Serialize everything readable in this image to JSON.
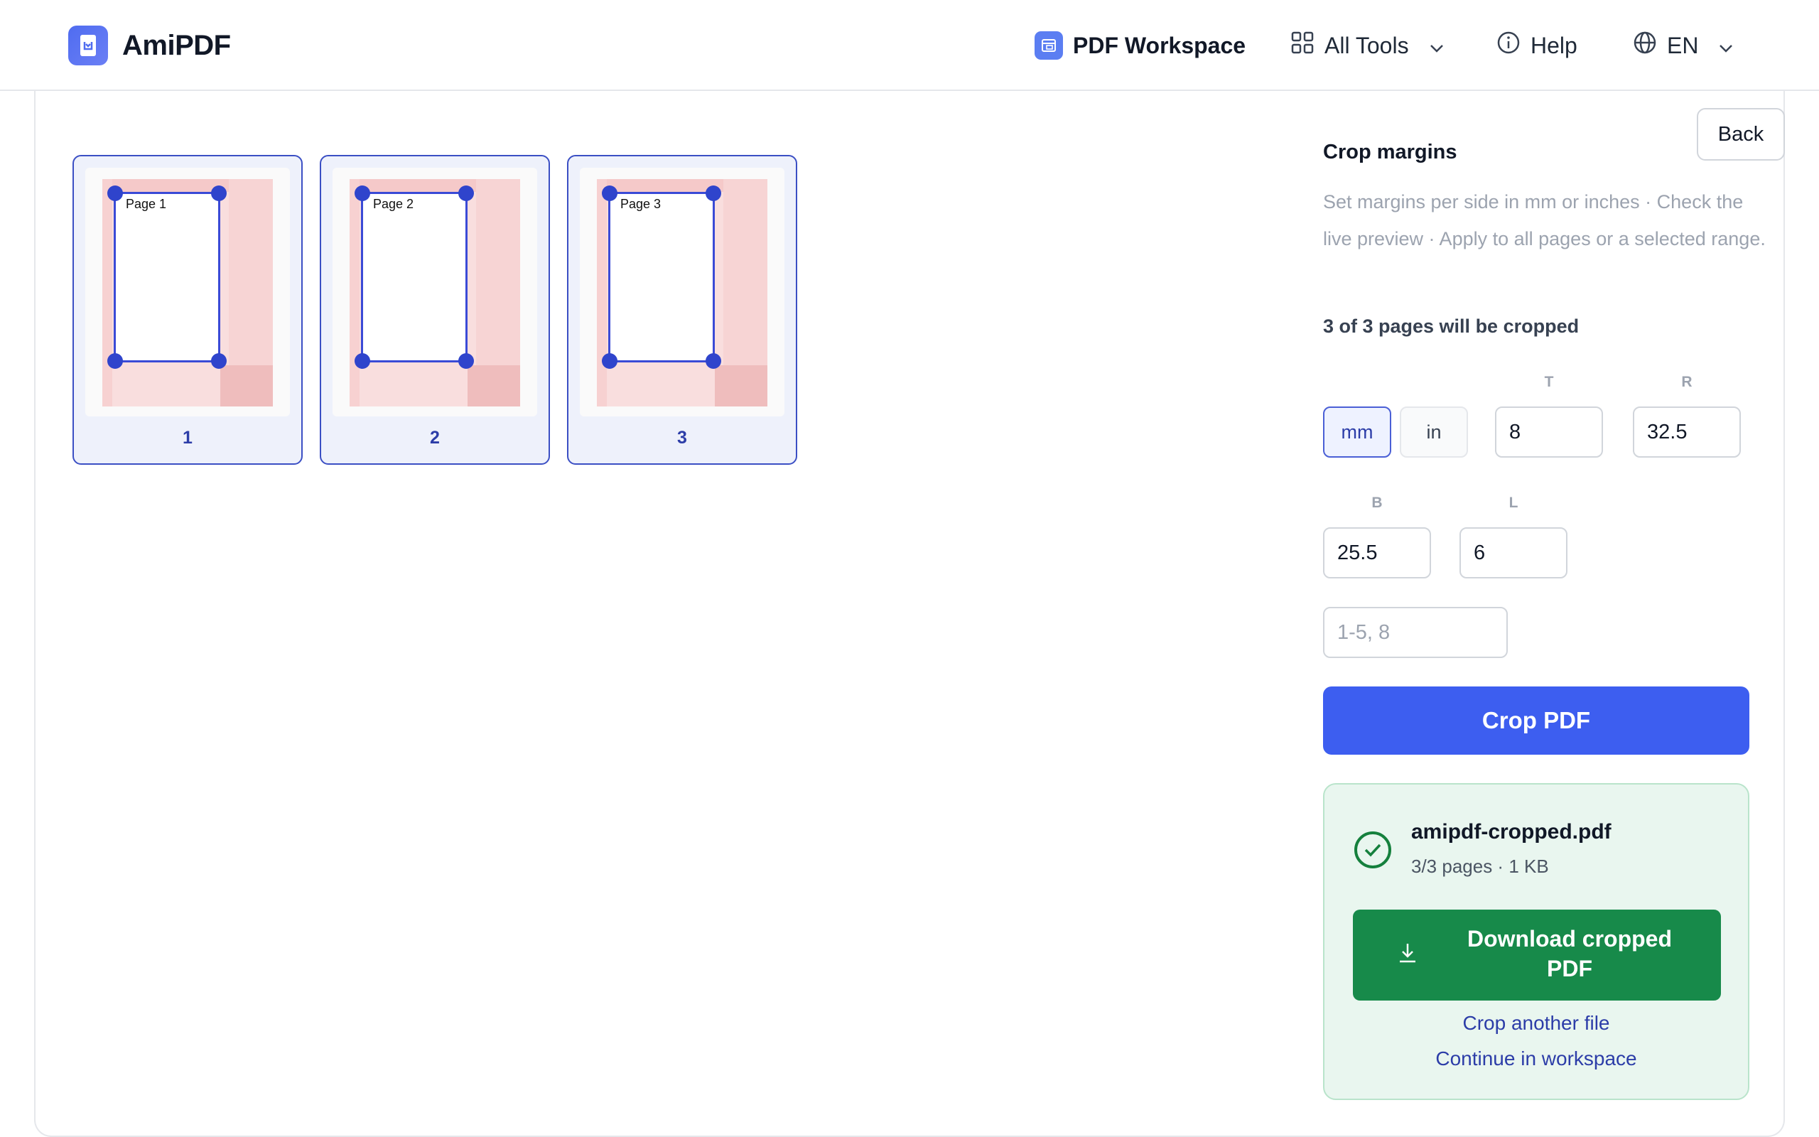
{
  "header": {
    "brand": "AmiPDF",
    "workspace": "PDF Workspace",
    "all_tools": "All Tools",
    "help": "Help",
    "lang": "EN"
  },
  "thumbnails": [
    {
      "label": "Page 1",
      "number": "1"
    },
    {
      "label": "Page 2",
      "number": "2"
    },
    {
      "label": "Page 3",
      "number": "3"
    }
  ],
  "side": {
    "back": "Back",
    "title": "Crop margins",
    "description": "Set margins per side in mm or inches · Check the live preview · Apply to all pages or a selected range.",
    "count": "3 of 3 pages will be cropped",
    "units": {
      "mm": "mm",
      "in": "in",
      "selected": "mm"
    },
    "labels": {
      "t": "T",
      "r": "R",
      "b": "B",
      "l": "L"
    },
    "values": {
      "t": "8",
      "r": "32.5",
      "b": "25.5",
      "l": "6"
    },
    "range_placeholder": "1-5, 8",
    "crop_button": "Crop PDF"
  },
  "result": {
    "filename": "amipdf-cropped.pdf",
    "meta": "3/3 pages · 1 KB",
    "download": "Download cropped PDF",
    "crop_another": "Crop another file",
    "continue": "Continue in workspace"
  },
  "colors": {
    "accent": "#3d5ef0",
    "success": "#178a4a",
    "crop_outline": "#3a4ad6"
  }
}
